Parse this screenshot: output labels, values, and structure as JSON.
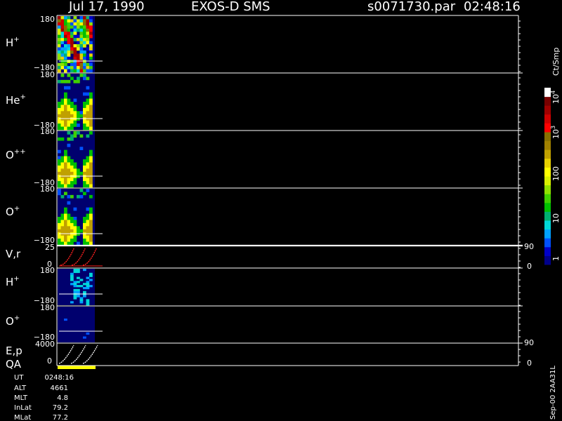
{
  "header": {
    "date": "Jul 17, 1990",
    "instrument": "EXOS-D SMS",
    "file": "s0071730.par",
    "time": "02:48:16"
  },
  "colorbar": {
    "unit": "Ct/Smp",
    "labels": [
      "1",
      "10",
      "100",
      "10",
      "10"
    ],
    "exponents": [
      "",
      "",
      "",
      "3",
      "4"
    ],
    "colors": [
      "#00008a",
      "#0000c8",
      "#0050ff",
      "#00a0ff",
      "#00d8d8",
      "#00b070",
      "#00c000",
      "#40d000",
      "#90e000",
      "#d8f000",
      "#ffff00",
      "#e8d000",
      "#c0a000",
      "#a08000",
      "#887000",
      "#ff0000",
      "#d00000",
      "#a00000",
      "#780000",
      "#ffffff"
    ]
  },
  "footer": {
    "ut_label": "UT",
    "ut_value": "0248:16",
    "alt_label": "ALT",
    "alt_value": "4661",
    "mlt_label": "MLT",
    "mlt_value": "4.8",
    "inlat_label": "InLat",
    "inlat_value": "79.2",
    "mlat_label": "MLat",
    "mlat_value": "77.2",
    "version": "Sep-00 2AA31L"
  },
  "chart_data": [
    {
      "type": "heatmap",
      "panel": "H+",
      "ion": "H",
      "charge": "+",
      "ylim": [
        -180,
        180
      ],
      "ticks": [
        "180",
        "−180"
      ]
    },
    {
      "type": "heatmap",
      "panel": "He+",
      "ion": "He",
      "charge": "+",
      "ylim": [
        -180,
        180
      ],
      "ticks": [
        "180",
        "−180"
      ]
    },
    {
      "type": "heatmap",
      "panel": "O++",
      "ion": "O",
      "charge": "++",
      "ylim": [
        -180,
        180
      ],
      "ticks": [
        "180",
        "−180"
      ]
    },
    {
      "type": "heatmap",
      "panel": "O+",
      "ion": "O",
      "charge": "+",
      "ylim": [
        -180,
        180
      ],
      "ticks": [
        "180",
        "−180"
      ]
    },
    {
      "type": "line",
      "panel": "V,r",
      "ylabel": "V,r",
      "ylim": [
        0,
        25
      ],
      "y2lim": [
        0,
        90
      ],
      "ticks": [
        "25",
        "0"
      ],
      "right_ticks": [
        "90",
        "0"
      ],
      "color": "#ff2020"
    },
    {
      "type": "heatmap",
      "panel": "H+ (2)",
      "ion": "H",
      "charge": "+",
      "ylim": [
        -180,
        180
      ],
      "ticks": [
        "180",
        "−180"
      ]
    },
    {
      "type": "heatmap",
      "panel": "O+ (2)",
      "ion": "O",
      "charge": "+",
      "ylim": [
        -180,
        180
      ],
      "ticks": [
        "180",
        "−180"
      ]
    },
    {
      "type": "line",
      "panel": "E,p / QA",
      "ylabel": "E,p",
      "ylabel2": "QA",
      "ylim": [
        0,
        4000
      ],
      "y2lim": [
        0,
        90
      ],
      "ticks": [
        "4000",
        "0"
      ],
      "right_ticks": [
        "90",
        "0"
      ],
      "color": "#ffffff",
      "qa_color": "#ffff00"
    }
  ]
}
